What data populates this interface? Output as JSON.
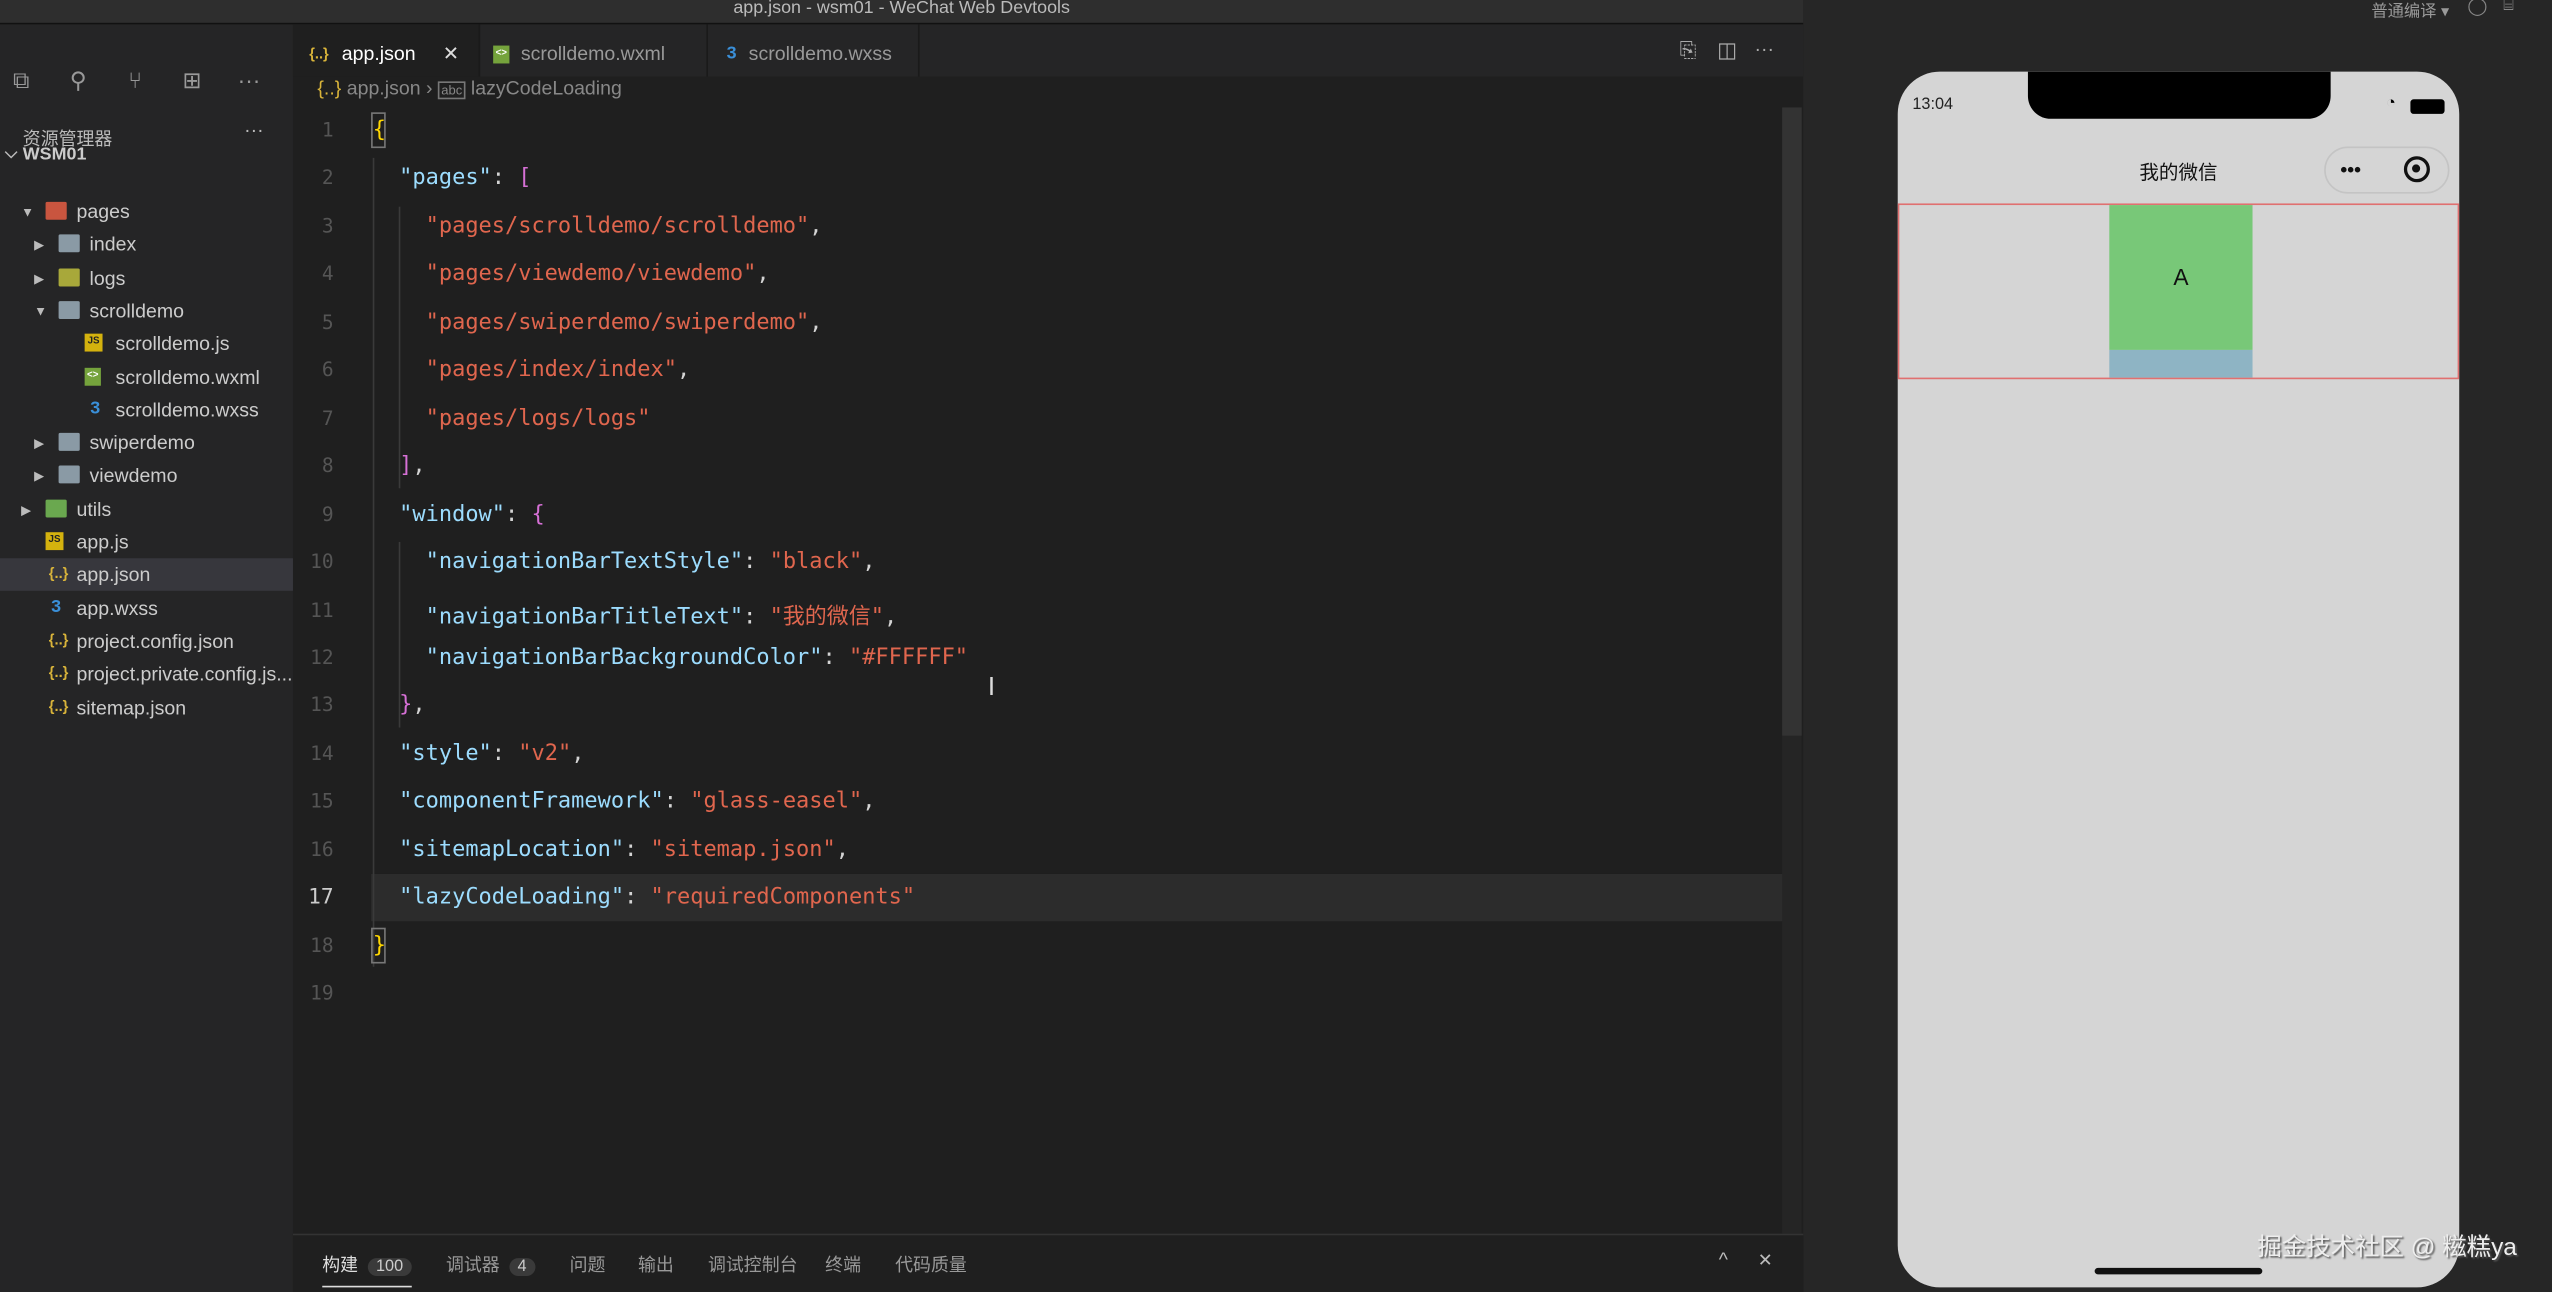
{
  "window_title": "app.json - wsm01 - WeChat Web Devtools",
  "toolbar_right": {
    "compile_mode": "普通编译 ▾"
  },
  "activity_bar": [
    {
      "icon": "files-icon",
      "glyph": "⧉"
    },
    {
      "icon": "search-icon",
      "glyph": "⚲"
    },
    {
      "icon": "source-control-icon",
      "glyph": "⑂"
    },
    {
      "icon": "extensions-icon",
      "glyph": "⊞"
    },
    {
      "icon": "more-icon",
      "glyph": "···"
    }
  ],
  "explorer": {
    "title": "资源管理器",
    "more": "···",
    "root": "WSM01",
    "items": [
      {
        "label": "pages",
        "depth": 1,
        "type": "folder-pages",
        "twisty": "open"
      },
      {
        "label": "index",
        "depth": 2,
        "type": "folder",
        "twisty": "closed"
      },
      {
        "label": "logs",
        "depth": 2,
        "type": "folder-logs",
        "twisty": "closed"
      },
      {
        "label": "scrolldemo",
        "depth": 2,
        "type": "folder",
        "twisty": "open"
      },
      {
        "label": "scrolldemo.js",
        "depth": 3,
        "type": "js"
      },
      {
        "label": "scrolldemo.wxml",
        "depth": 3,
        "type": "wxml"
      },
      {
        "label": "scrolldemo.wxss",
        "depth": 3,
        "type": "wxss"
      },
      {
        "label": "swiperdemo",
        "depth": 2,
        "type": "folder",
        "twisty": "closed"
      },
      {
        "label": "viewdemo",
        "depth": 2,
        "type": "folder",
        "twisty": "closed"
      },
      {
        "label": "utils",
        "depth": 1,
        "type": "folder-utils",
        "twisty": "closed"
      },
      {
        "label": "app.js",
        "depth": 1,
        "type": "js"
      },
      {
        "label": "app.json",
        "depth": 1,
        "type": "json",
        "selected": true
      },
      {
        "label": "app.wxss",
        "depth": 1,
        "type": "wxss"
      },
      {
        "label": "project.config.json",
        "depth": 1,
        "type": "json"
      },
      {
        "label": "project.private.config.js...",
        "depth": 1,
        "type": "json"
      },
      {
        "label": "sitemap.json",
        "depth": 1,
        "type": "json"
      }
    ]
  },
  "tabs": [
    {
      "label": "app.json",
      "type": "json",
      "active": true,
      "close": "✕"
    },
    {
      "label": "scrolldemo.wxml",
      "type": "wxml"
    },
    {
      "label": "scrolldemo.wxss",
      "type": "wxss"
    }
  ],
  "breadcrumb": {
    "file": "app.json",
    "symbol": "lazyCodeLoading"
  },
  "editor": {
    "current_line": 17,
    "lines": [
      [
        [
          "{",
          "b1"
        ]
      ],
      [
        [
          "  ",
          ""
        ],
        [
          "\"pages\"",
          "k"
        ],
        [
          ": ",
          "p"
        ],
        [
          "[",
          "b2"
        ]
      ],
      [
        [
          "    ",
          ""
        ],
        [
          "\"pages/scrolldemo/scrolldemo\"",
          "s"
        ],
        [
          ",",
          "p"
        ]
      ],
      [
        [
          "    ",
          ""
        ],
        [
          "\"pages/viewdemo/viewdemo\"",
          "s"
        ],
        [
          ",",
          "p"
        ]
      ],
      [
        [
          "    ",
          ""
        ],
        [
          "\"pages/swiperdemo/swiperdemo\"",
          "s"
        ],
        [
          ",",
          "p"
        ]
      ],
      [
        [
          "    ",
          ""
        ],
        [
          "\"pages/index/index\"",
          "s"
        ],
        [
          ",",
          "p"
        ]
      ],
      [
        [
          "    ",
          ""
        ],
        [
          "\"pages/logs/logs\"",
          "s"
        ]
      ],
      [
        [
          "  ",
          ""
        ],
        [
          "]",
          "b2"
        ],
        [
          ",",
          "p"
        ]
      ],
      [
        [
          "  ",
          ""
        ],
        [
          "\"window\"",
          "k"
        ],
        [
          ": ",
          "p"
        ],
        [
          "{",
          "b2"
        ]
      ],
      [
        [
          "    ",
          ""
        ],
        [
          "\"navigationBarTextStyle\"",
          "k"
        ],
        [
          ": ",
          "p"
        ],
        [
          "\"black\"",
          "s"
        ],
        [
          ",",
          "p"
        ]
      ],
      [
        [
          "    ",
          ""
        ],
        [
          "\"navigationBarTitleText\"",
          "k"
        ],
        [
          ": ",
          "p"
        ],
        [
          "\"我的微信\"",
          "s"
        ],
        [
          ",",
          "p"
        ]
      ],
      [
        [
          "    ",
          ""
        ],
        [
          "\"navigationBarBackgroundColor\"",
          "k"
        ],
        [
          ": ",
          "p"
        ],
        [
          "\"#FFFFFF\"",
          "s"
        ]
      ],
      [
        [
          "  ",
          ""
        ],
        [
          "}",
          "b2"
        ],
        [
          ",",
          "p"
        ]
      ],
      [
        [
          "  ",
          ""
        ],
        [
          "\"style\"",
          "k"
        ],
        [
          ": ",
          "p"
        ],
        [
          "\"v2\"",
          "s"
        ],
        [
          ",",
          "p"
        ]
      ],
      [
        [
          "  ",
          ""
        ],
        [
          "\"componentFramework\"",
          "k"
        ],
        [
          ": ",
          "p"
        ],
        [
          "\"glass-easel\"",
          "s"
        ],
        [
          ",",
          "p"
        ]
      ],
      [
        [
          "  ",
          ""
        ],
        [
          "\"sitemapLocation\"",
          "k"
        ],
        [
          ": ",
          "p"
        ],
        [
          "\"sitemap.json\"",
          "s"
        ],
        [
          ",",
          "p"
        ]
      ],
      [
        [
          "  ",
          ""
        ],
        [
          "\"lazyCodeLoading\"",
          "k"
        ],
        [
          ": ",
          "p"
        ],
        [
          "\"requiredComponents\"",
          "s"
        ]
      ],
      [
        [
          "}",
          "b1"
        ]
      ],
      []
    ]
  },
  "panel": {
    "tabs": [
      {
        "label": "构建",
        "badge": "100",
        "active": true
      },
      {
        "label": "调试器",
        "badge": "4"
      },
      {
        "label": "问题"
      },
      {
        "label": "输出"
      },
      {
        "label": "调试控制台"
      },
      {
        "label": "终端"
      },
      {
        "label": "代码质量"
      }
    ],
    "collapse": "^",
    "close": "✕"
  },
  "simulator": {
    "time": "13:04",
    "nav_title": "我的微信",
    "capsule_more": "•••",
    "item_label": "A",
    "colors": {
      "item": "#78c878",
      "item2": "#8eb4c4",
      "border": "#e07070"
    }
  },
  "watermark": "掘金技术社区 @ 糍糕ya"
}
